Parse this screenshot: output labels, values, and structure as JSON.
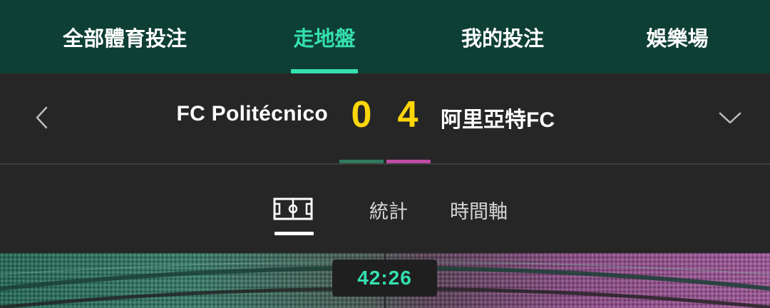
{
  "nav": {
    "tabs": [
      {
        "label": "全部體育投注"
      },
      {
        "label": "走地盤",
        "active": true
      },
      {
        "label": "我的投注"
      },
      {
        "label": "娛樂場"
      }
    ]
  },
  "match": {
    "home_team": "FC Politécnico",
    "away_team": "阿里亞特FC",
    "home_score": "0",
    "away_score": "4",
    "home_color": "#2f7a5d",
    "away_color": "#c04aa8"
  },
  "sub_tabs": {
    "pitch_icon": "pitch-icon",
    "stats_label": "統計",
    "timeline_label": "時間軸"
  },
  "clock": {
    "time": "42:26"
  },
  "colors": {
    "accent": "#35e0b0",
    "score": "#ffd60a",
    "nav_bg": "#0e3f34"
  }
}
